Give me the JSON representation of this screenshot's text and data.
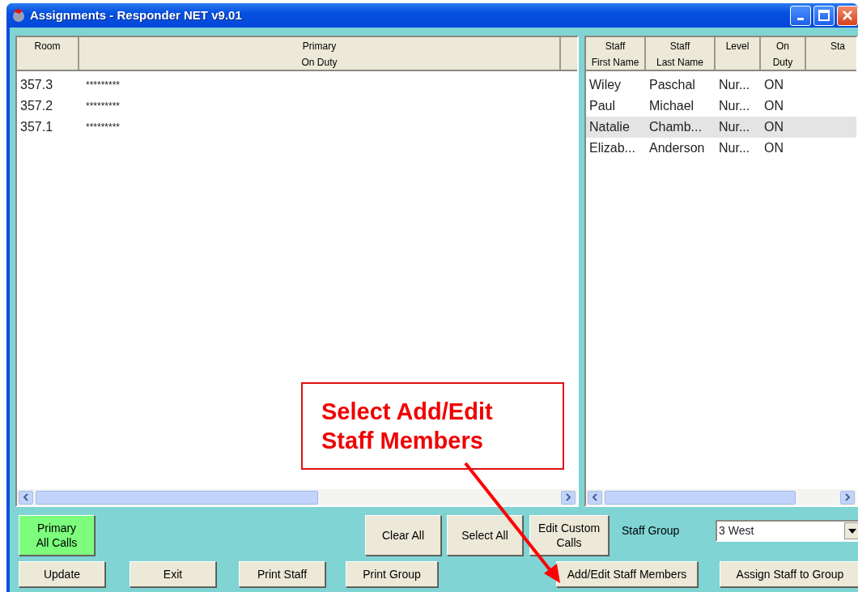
{
  "window": {
    "title": "Assignments - Responder NET v9.01"
  },
  "room_table": {
    "columns": [
      {
        "lines": [
          "Room"
        ]
      },
      {
        "lines": [
          "Primary",
          "On Duty"
        ]
      }
    ],
    "rows": [
      {
        "room": "357.3",
        "primary": "*********"
      },
      {
        "room": "357.2",
        "primary": "*********"
      },
      {
        "room": "357.1",
        "primary": "*********"
      }
    ]
  },
  "staff_table": {
    "columns": [
      {
        "lines": [
          "Staff",
          "First Name"
        ]
      },
      {
        "lines": [
          "Staff",
          "Last Name"
        ]
      },
      {
        "lines": [
          "Level"
        ]
      },
      {
        "lines": [
          "On",
          "Duty"
        ]
      },
      {
        "lines": [
          "Sta"
        ]
      }
    ],
    "rows": [
      {
        "cells": [
          "Wiley",
          "Paschal",
          "Nur...",
          "ON"
        ],
        "selected": false
      },
      {
        "cells": [
          "Paul",
          "Michael",
          "Nur...",
          "ON"
        ],
        "selected": false
      },
      {
        "cells": [
          "Natalie",
          "Chamb...",
          "Nur...",
          "ON"
        ],
        "selected": true
      },
      {
        "cells": [
          "Elizab...",
          "Anderson",
          "Nur...",
          "ON"
        ],
        "selected": false
      }
    ]
  },
  "top_buttons": [
    {
      "lines": [
        "Primary",
        "All Calls"
      ],
      "on": true
    },
    {
      "lines": [
        "Clear All"
      ],
      "on": false
    },
    {
      "lines": [
        "Select All"
      ],
      "on": false
    },
    {
      "lines": [
        "Edit Custom",
        "Calls"
      ],
      "on": false
    }
  ],
  "staff_group": {
    "label": "Staff Group",
    "value": "3 West"
  },
  "bottom_buttons": [
    "Update",
    "Exit",
    "Print Staff",
    "Print Group",
    "Add/Edit Staff Members",
    "Assign Staff to Group"
  ],
  "callout": {
    "lines": [
      "Select Add/Edit",
      "Staff Members"
    ]
  }
}
